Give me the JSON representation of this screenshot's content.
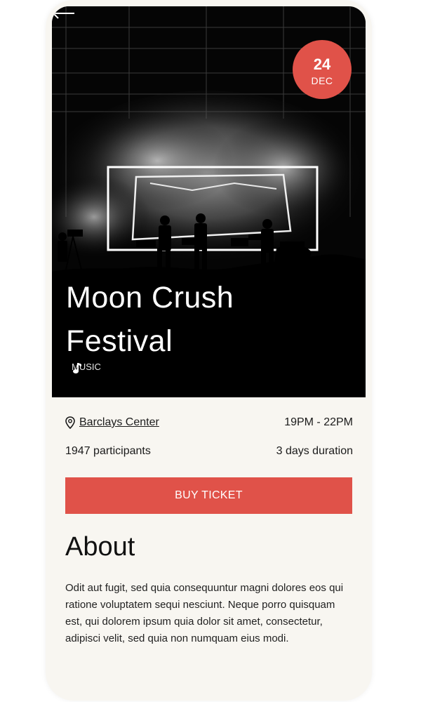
{
  "event": {
    "date_day": "24",
    "date_month": "DEC",
    "title_line1": "Moon Crush",
    "title_line2": "Festival",
    "category": "MUSIC",
    "venue": "Barclays Center",
    "time": "19PM - 22PM",
    "participants": "1947 participants",
    "duration": "3 days duration"
  },
  "actions": {
    "buy_label": "BUY TICKET"
  },
  "about": {
    "heading": "About",
    "text": "Odit aut fugit, sed quia consequuntur magni dolores eos qui ratione voluptatem sequi nesciunt. Neque porro quisquam est, qui dolorem ipsum quia dolor sit amet, consectetur, adipisci velit, sed quia non numquam eius modi."
  },
  "icons": {
    "back": "arrow-left-icon",
    "category": "music-note-icon",
    "location": "location-pin-icon"
  },
  "colors": {
    "accent": "#e05249",
    "background": "#f8f6f1",
    "hero": "#000000"
  }
}
